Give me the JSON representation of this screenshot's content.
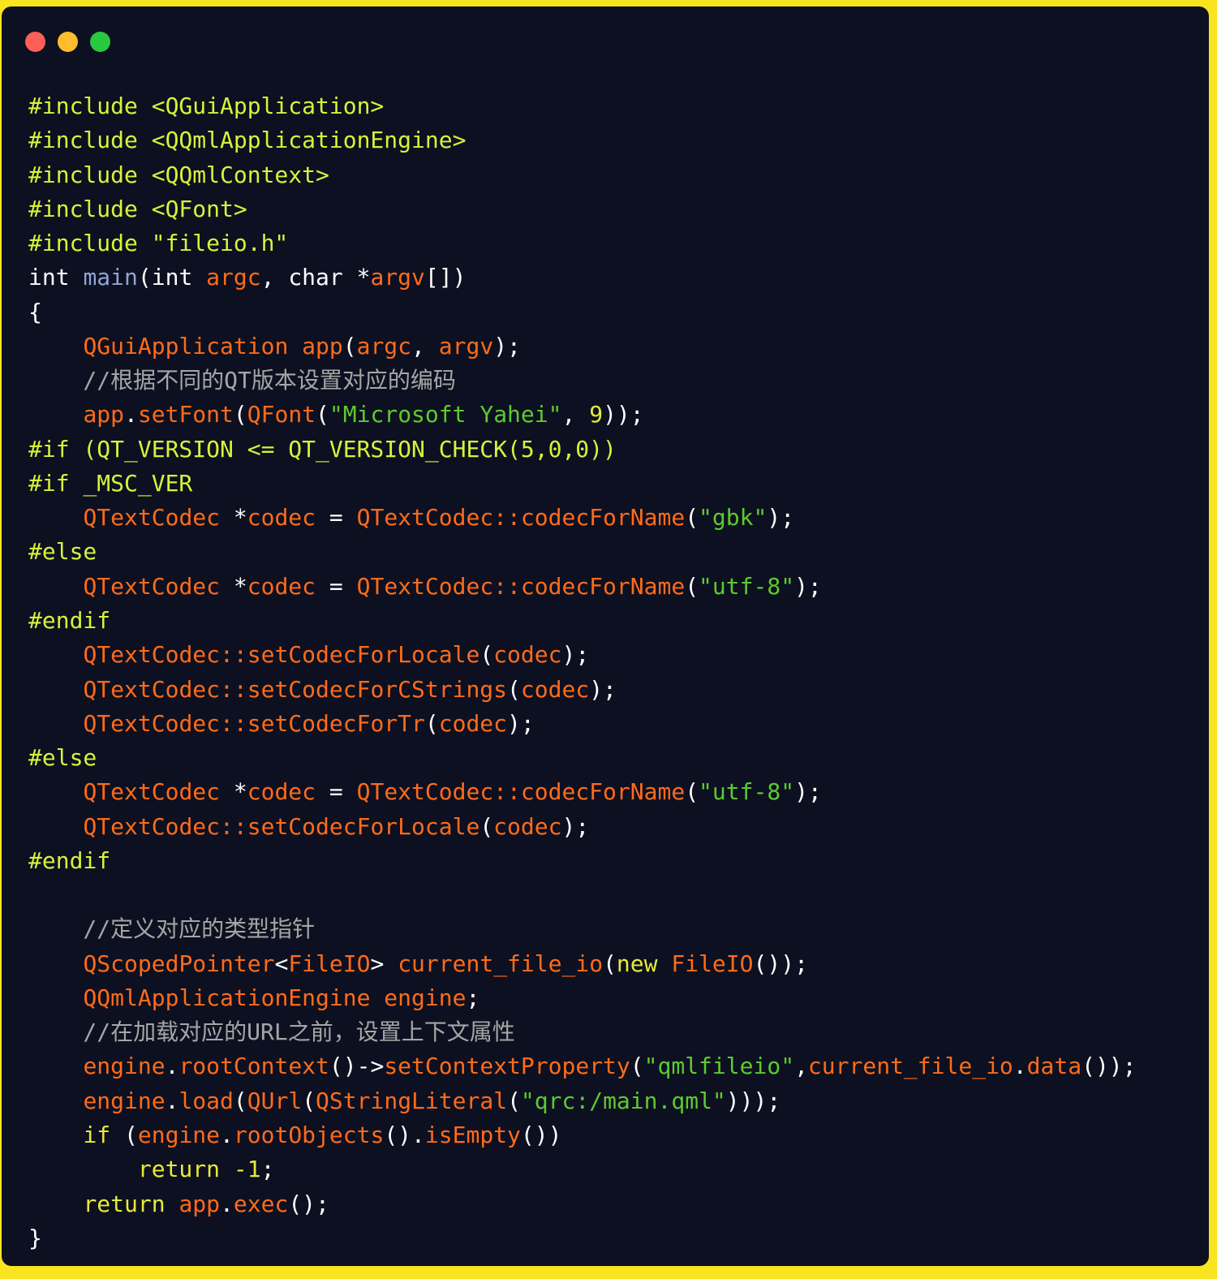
{
  "colors": {
    "frame": "#f9e51f",
    "background": "#0d1020",
    "close": "#ff5f57",
    "minimize": "#febc2e",
    "maximize": "#28c840",
    "preprocessor": "#d8f23a",
    "identifier": "#ff6b1a",
    "string": "#5ccb2e",
    "comment": "#a6a6a6",
    "function": "#8fa4d6"
  },
  "window_controls": [
    "close",
    "minimize",
    "maximize"
  ],
  "lines": [
    [
      [
        "p",
        "#include <QGuiApplication>"
      ]
    ],
    [
      [
        "p",
        "#include <QQmlApplicationEngine>"
      ]
    ],
    [
      [
        "p",
        "#include <QQmlContext>"
      ]
    ],
    [
      [
        "p",
        "#include <QFont>"
      ]
    ],
    [
      [
        "p",
        "#include \"fileio.h\""
      ]
    ],
    [
      [
        "w",
        "int "
      ],
      [
        "b",
        "main"
      ],
      [
        "w",
        "(int "
      ],
      [
        "o",
        "argc"
      ],
      [
        "w",
        ", char *"
      ],
      [
        "o",
        "argv"
      ],
      [
        "w",
        "[])"
      ]
    ],
    [
      [
        "w",
        "{"
      ]
    ],
    [
      [
        "w",
        "    "
      ],
      [
        "o",
        "QGuiApplication app"
      ],
      [
        "w",
        "("
      ],
      [
        "o",
        "argc"
      ],
      [
        "w",
        ", "
      ],
      [
        "o",
        "argv"
      ],
      [
        "w",
        ");"
      ]
    ],
    [
      [
        "c",
        "    //根据不同的QT版本设置对应的编码"
      ]
    ],
    [
      [
        "w",
        "    "
      ],
      [
        "o",
        "app"
      ],
      [
        "w",
        "."
      ],
      [
        "o",
        "setFont"
      ],
      [
        "w",
        "("
      ],
      [
        "o",
        "QFont"
      ],
      [
        "w",
        "("
      ],
      [
        "g",
        "\"Microsoft Yahei\""
      ],
      [
        "w",
        ", "
      ],
      [
        "y",
        "9"
      ],
      [
        "w",
        "));"
      ]
    ],
    [
      [
        "p",
        "#if (QT_VERSION <= QT_VERSION_CHECK(5,0,0))"
      ]
    ],
    [
      [
        "p",
        "#if _MSC_VER"
      ]
    ],
    [
      [
        "w",
        "    "
      ],
      [
        "o",
        "QTextCodec "
      ],
      [
        "w",
        "*"
      ],
      [
        "o",
        "codec "
      ],
      [
        "w",
        "= "
      ],
      [
        "o",
        "QTextCodec::codecForName"
      ],
      [
        "w",
        "("
      ],
      [
        "g",
        "\"gbk\""
      ],
      [
        "w",
        ");"
      ]
    ],
    [
      [
        "p",
        "#else"
      ]
    ],
    [
      [
        "w",
        "    "
      ],
      [
        "o",
        "QTextCodec "
      ],
      [
        "w",
        "*"
      ],
      [
        "o",
        "codec "
      ],
      [
        "w",
        "= "
      ],
      [
        "o",
        "QTextCodec::codecForName"
      ],
      [
        "w",
        "("
      ],
      [
        "g",
        "\"utf-8\""
      ],
      [
        "w",
        ");"
      ]
    ],
    [
      [
        "p",
        "#endif"
      ]
    ],
    [
      [
        "w",
        "    "
      ],
      [
        "o",
        "QTextCodec::setCodecForLocale"
      ],
      [
        "w",
        "("
      ],
      [
        "o",
        "codec"
      ],
      [
        "w",
        ");"
      ]
    ],
    [
      [
        "w",
        "    "
      ],
      [
        "o",
        "QTextCodec::setCodecForCStrings"
      ],
      [
        "w",
        "("
      ],
      [
        "o",
        "codec"
      ],
      [
        "w",
        ");"
      ]
    ],
    [
      [
        "w",
        "    "
      ],
      [
        "o",
        "QTextCodec::setCodecForTr"
      ],
      [
        "w",
        "("
      ],
      [
        "o",
        "codec"
      ],
      [
        "w",
        ");"
      ]
    ],
    [
      [
        "p",
        "#else"
      ]
    ],
    [
      [
        "w",
        "    "
      ],
      [
        "o",
        "QTextCodec "
      ],
      [
        "w",
        "*"
      ],
      [
        "o",
        "codec "
      ],
      [
        "w",
        "= "
      ],
      [
        "o",
        "QTextCodec::codecForName"
      ],
      [
        "w",
        "("
      ],
      [
        "g",
        "\"utf-8\""
      ],
      [
        "w",
        ");"
      ]
    ],
    [
      [
        "w",
        "    "
      ],
      [
        "o",
        "QTextCodec::setCodecForLocale"
      ],
      [
        "w",
        "("
      ],
      [
        "o",
        "codec"
      ],
      [
        "w",
        ");"
      ]
    ],
    [
      [
        "p",
        "#endif"
      ]
    ],
    [],
    [
      [
        "c",
        "    //定义对应的类型指针"
      ]
    ],
    [
      [
        "w",
        "    "
      ],
      [
        "o",
        "QScopedPointer"
      ],
      [
        "w",
        "<"
      ],
      [
        "o",
        "FileIO"
      ],
      [
        "w",
        "> "
      ],
      [
        "o",
        "current_file_io"
      ],
      [
        "w",
        "("
      ],
      [
        "y",
        "new "
      ],
      [
        "o",
        "FileIO"
      ],
      [
        "w",
        "());"
      ]
    ],
    [
      [
        "w",
        "    "
      ],
      [
        "o",
        "QQmlApplicationEngine engine"
      ],
      [
        "w",
        ";"
      ]
    ],
    [
      [
        "c",
        "    //在加载对应的URL之前，设置上下文属性"
      ]
    ],
    [
      [
        "w",
        "    "
      ],
      [
        "o",
        "engine"
      ],
      [
        "w",
        "."
      ],
      [
        "o",
        "rootContext"
      ],
      [
        "w",
        "()->"
      ],
      [
        "o",
        "setContextProperty"
      ],
      [
        "w",
        "("
      ],
      [
        "g",
        "\"qmlfileio\""
      ],
      [
        "w",
        ","
      ],
      [
        "o",
        "current_file_io"
      ],
      [
        "w",
        "."
      ],
      [
        "o",
        "data"
      ],
      [
        "w",
        "());"
      ]
    ],
    [
      [
        "w",
        "    "
      ],
      [
        "o",
        "engine"
      ],
      [
        "w",
        "."
      ],
      [
        "o",
        "load"
      ],
      [
        "w",
        "("
      ],
      [
        "o",
        "QUrl"
      ],
      [
        "w",
        "("
      ],
      [
        "o",
        "QStringLiteral"
      ],
      [
        "w",
        "("
      ],
      [
        "g",
        "\"qrc:/main.qml\""
      ],
      [
        "w",
        ")));"
      ]
    ],
    [
      [
        "w",
        "    "
      ],
      [
        "y",
        "if "
      ],
      [
        "w",
        "("
      ],
      [
        "o",
        "engine"
      ],
      [
        "w",
        "."
      ],
      [
        "o",
        "rootObjects"
      ],
      [
        "w",
        "()."
      ],
      [
        "o",
        "isEmpty"
      ],
      [
        "w",
        "())"
      ]
    ],
    [
      [
        "y",
        "        return -1"
      ],
      [
        "w",
        ";"
      ]
    ],
    [
      [
        "w",
        "    "
      ],
      [
        "y",
        "return "
      ],
      [
        "o",
        "app"
      ],
      [
        "w",
        "."
      ],
      [
        "o",
        "exec"
      ],
      [
        "w",
        "();"
      ]
    ],
    [
      [
        "w",
        "}"
      ]
    ]
  ]
}
